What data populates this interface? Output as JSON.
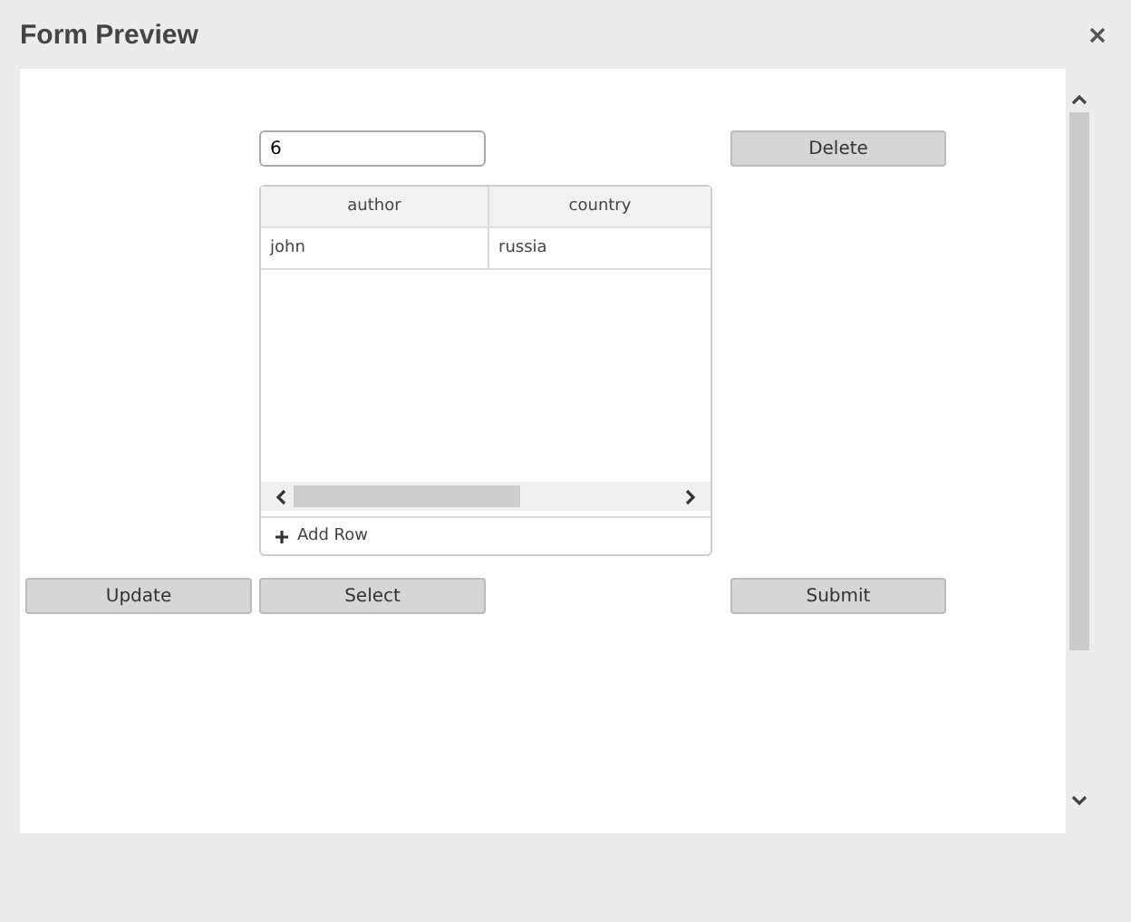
{
  "window": {
    "title": "Form Preview"
  },
  "field": {
    "value": "6"
  },
  "top_button": {
    "label": "Delete"
  },
  "table": {
    "columns": [
      "author",
      "country"
    ],
    "rows": [
      [
        "john",
        "russia"
      ]
    ],
    "add_row": "Add Row"
  },
  "buttons": [
    {
      "label": "Update"
    },
    {
      "label": "Select"
    },
    {
      "label": "Submit"
    }
  ]
}
